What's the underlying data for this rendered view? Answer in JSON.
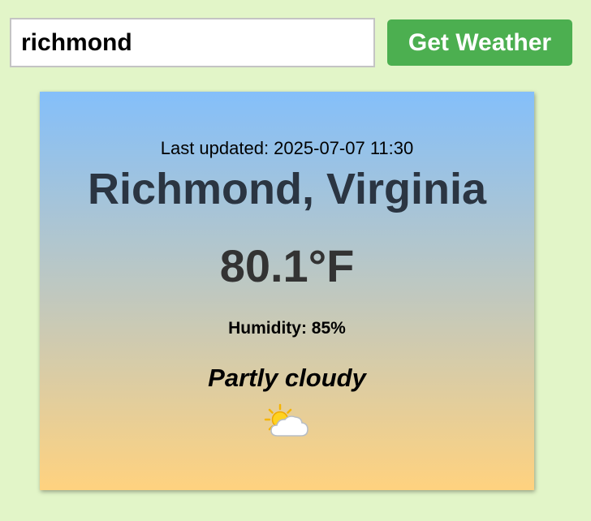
{
  "search": {
    "value": "richmond"
  },
  "button": {
    "label": "Get Weather"
  },
  "weather": {
    "last_updated": "Last updated: 2025-07-07 11:30",
    "location": "Richmond, Virginia",
    "temperature": "80.1°F",
    "humidity": "Humidity: 85%",
    "condition": "Partly cloudy",
    "condition_icon": "partly-cloudy-icon"
  },
  "colors": {
    "page_background": "#e2f5c8",
    "button_background": "#4caf50",
    "card_gradient_top": "#84bffa",
    "card_gradient_bottom": "#ffd27f"
  }
}
